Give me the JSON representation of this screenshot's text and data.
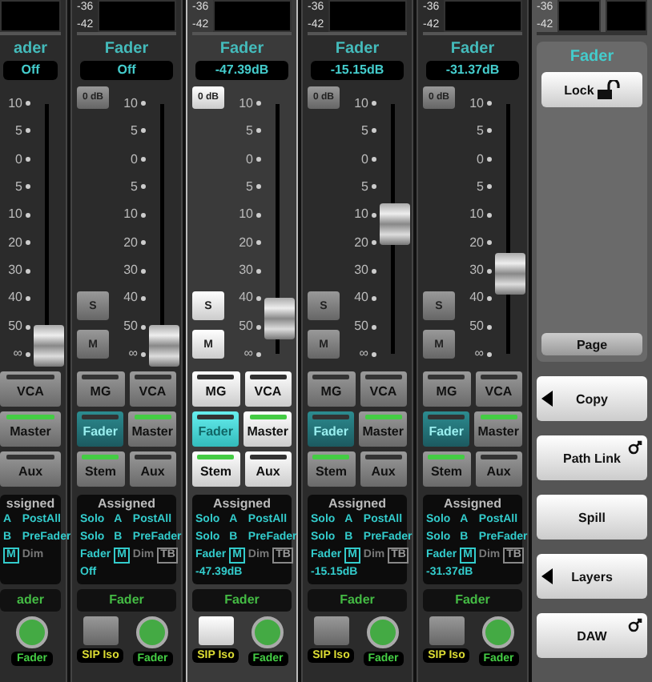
{
  "strips": [
    {
      "kind": "partial",
      "selected": false,
      "title": "ader",
      "value": "Off",
      "scale": [
        "10",
        "5",
        "0",
        "5",
        "10",
        "20",
        "30",
        "40",
        "50",
        "∞"
      ],
      "level": 0.03,
      "buttons": [
        [
          {
            "label": "VCA",
            "lit": false,
            "highlighted": false
          }
        ],
        [
          {
            "label": "Master",
            "lit": true,
            "highlighted": false
          }
        ],
        [
          {
            "label": "Aux",
            "lit": false,
            "highlighted": false
          }
        ]
      ],
      "assigned": {
        "title": "ssigned",
        "rows": [
          [
            {
              "text": "A",
              "kind": "text"
            },
            {
              "text": "PostAll",
              "kind": "text"
            }
          ],
          [
            {
              "text": "B",
              "kind": "text"
            },
            {
              "text": "PreFader",
              "kind": "text"
            }
          ],
          [
            {
              "text": "M",
              "kind": "box"
            },
            {
              "text": "Dim",
              "kind": "dim"
            }
          ]
        ]
      },
      "bar_label": "ader",
      "bottom": [
        {
          "kind": "round",
          "label": "Fader"
        }
      ]
    },
    {
      "kind": "full",
      "selected": false,
      "meter_labels": [
        "-36",
        "-42"
      ],
      "title": "Fader",
      "value": "Off",
      "zero_db": "0 dB",
      "scale": [
        "10",
        "5",
        "0",
        "5",
        "10",
        "20",
        "30",
        "40",
        "50",
        "∞"
      ],
      "level": 0.03,
      "solo": "S",
      "mute": "M",
      "buttons": [
        [
          {
            "label": "MG",
            "lit": false,
            "highlighted": false
          },
          {
            "label": "VCA",
            "lit": false,
            "highlighted": false
          }
        ],
        [
          {
            "label": "Fader",
            "lit": false,
            "highlighted": true
          },
          {
            "label": "Master",
            "lit": true,
            "highlighted": false
          }
        ],
        [
          {
            "label": "Stem",
            "lit": true,
            "highlighted": false
          },
          {
            "label": "Aux",
            "lit": false,
            "highlighted": false
          }
        ]
      ],
      "assigned": {
        "title": "Assigned",
        "rows": [
          [
            {
              "text": "Solo",
              "kind": "text"
            },
            {
              "text": "A",
              "kind": "text"
            },
            {
              "text": "PostAll",
              "kind": "text"
            }
          ],
          [
            {
              "text": "Solo",
              "kind": "text"
            },
            {
              "text": "B",
              "kind": "text"
            },
            {
              "text": "PreFader",
              "kind": "text"
            }
          ],
          [
            {
              "text": "Fader",
              "kind": "text"
            },
            {
              "text": "M",
              "kind": "box"
            },
            {
              "text": "Dim",
              "kind": "dim"
            },
            {
              "text": "TB",
              "kind": "dimbox"
            }
          ],
          [
            {
              "text": "Off",
              "kind": "text"
            }
          ]
        ]
      },
      "bar_label": "Fader",
      "bottom": [
        {
          "kind": "square",
          "label": "SIP Iso"
        },
        {
          "kind": "round",
          "label": "Fader"
        }
      ]
    },
    {
      "kind": "full",
      "selected": true,
      "meter_labels": [
        "-36",
        "-42"
      ],
      "title": "Fader",
      "value": "-47.39dB",
      "zero_db": "0 dB",
      "scale": [
        "10",
        "5",
        "0",
        "5",
        "10",
        "20",
        "30",
        "40",
        "50",
        "∞"
      ],
      "level": 0.14,
      "solo": "S",
      "mute": "M",
      "buttons": [
        [
          {
            "label": "MG",
            "lit": false,
            "highlighted": false
          },
          {
            "label": "VCA",
            "lit": false,
            "highlighted": false
          }
        ],
        [
          {
            "label": "Fader",
            "lit": false,
            "highlighted": true
          },
          {
            "label": "Master",
            "lit": true,
            "highlighted": false
          }
        ],
        [
          {
            "label": "Stem",
            "lit": true,
            "highlighted": false
          },
          {
            "label": "Aux",
            "lit": false,
            "highlighted": false
          }
        ]
      ],
      "assigned": {
        "title": "Assigned",
        "rows": [
          [
            {
              "text": "Solo",
              "kind": "text"
            },
            {
              "text": "A",
              "kind": "text"
            },
            {
              "text": "PostAll",
              "kind": "text"
            }
          ],
          [
            {
              "text": "Solo",
              "kind": "text"
            },
            {
              "text": "B",
              "kind": "text"
            },
            {
              "text": "PreFader",
              "kind": "text"
            }
          ],
          [
            {
              "text": "Fader",
              "kind": "text"
            },
            {
              "text": "M",
              "kind": "box"
            },
            {
              "text": "Dim",
              "kind": "dim"
            },
            {
              "text": "TB",
              "kind": "dimbox"
            }
          ],
          [
            {
              "text": "-47.39dB",
              "kind": "text"
            }
          ]
        ]
      },
      "bar_label": "Fader",
      "bottom": [
        {
          "kind": "square",
          "label": "SIP Iso"
        },
        {
          "kind": "round",
          "label": "Fader"
        }
      ]
    },
    {
      "kind": "full",
      "selected": false,
      "meter_labels": [
        "-36",
        "-42"
      ],
      "title": "Fader",
      "value": "-15.15dB",
      "zero_db": "0 dB",
      "scale": [
        "10",
        "5",
        "0",
        "5",
        "10",
        "20",
        "30",
        "40",
        "50",
        "∞"
      ],
      "level": 0.52,
      "solo": "S",
      "mute": "M",
      "buttons": [
        [
          {
            "label": "MG",
            "lit": false,
            "highlighted": false
          },
          {
            "label": "VCA",
            "lit": false,
            "highlighted": false
          }
        ],
        [
          {
            "label": "Fader",
            "lit": false,
            "highlighted": true
          },
          {
            "label": "Master",
            "lit": true,
            "highlighted": false
          }
        ],
        [
          {
            "label": "Stem",
            "lit": true,
            "highlighted": false
          },
          {
            "label": "Aux",
            "lit": false,
            "highlighted": false
          }
        ]
      ],
      "assigned": {
        "title": "Assigned",
        "rows": [
          [
            {
              "text": "Solo",
              "kind": "text"
            },
            {
              "text": "A",
              "kind": "text"
            },
            {
              "text": "PostAll",
              "kind": "text"
            }
          ],
          [
            {
              "text": "Solo",
              "kind": "text"
            },
            {
              "text": "B",
              "kind": "text"
            },
            {
              "text": "PreFader",
              "kind": "text"
            }
          ],
          [
            {
              "text": "Fader",
              "kind": "text"
            },
            {
              "text": "M",
              "kind": "box"
            },
            {
              "text": "Dim",
              "kind": "dim"
            },
            {
              "text": "TB",
              "kind": "dimbox"
            }
          ],
          [
            {
              "text": "-15.15dB",
              "kind": "text"
            }
          ]
        ]
      },
      "bar_label": "Fader",
      "bottom": [
        {
          "kind": "square",
          "label": "SIP Iso"
        },
        {
          "kind": "round",
          "label": "Fader"
        }
      ]
    },
    {
      "kind": "full",
      "selected": false,
      "meter_labels": [
        "-36",
        "-42"
      ],
      "title": "Fader",
      "value": "-31.37dB",
      "zero_db": "0 dB",
      "scale": [
        "10",
        "5",
        "0",
        "5",
        "10",
        "20",
        "30",
        "40",
        "50",
        "∞"
      ],
      "level": 0.32,
      "solo": "S",
      "mute": "M",
      "buttons": [
        [
          {
            "label": "MG",
            "lit": false,
            "highlighted": false
          },
          {
            "label": "VCA",
            "lit": false,
            "highlighted": false
          }
        ],
        [
          {
            "label": "Fader",
            "lit": false,
            "highlighted": true
          },
          {
            "label": "Master",
            "lit": true,
            "highlighted": false
          }
        ],
        [
          {
            "label": "Stem",
            "lit": true,
            "highlighted": false
          },
          {
            "label": "Aux",
            "lit": false,
            "highlighted": false
          }
        ]
      ],
      "assigned": {
        "title": "Assigned",
        "rows": [
          [
            {
              "text": "Solo",
              "kind": "text"
            },
            {
              "text": "A",
              "kind": "text"
            },
            {
              "text": "PostAll",
              "kind": "text"
            }
          ],
          [
            {
              "text": "Solo",
              "kind": "text"
            },
            {
              "text": "B",
              "kind": "text"
            },
            {
              "text": "PreFader",
              "kind": "text"
            }
          ],
          [
            {
              "text": "Fader",
              "kind": "text"
            },
            {
              "text": "M",
              "kind": "box"
            },
            {
              "text": "Dim",
              "kind": "dim"
            },
            {
              "text": "TB",
              "kind": "dimbox"
            }
          ],
          [
            {
              "text": "-31.37dB",
              "kind": "text"
            }
          ]
        ]
      },
      "bar_label": "Fader",
      "bottom": [
        {
          "kind": "square",
          "label": "SIP Iso"
        },
        {
          "kind": "round",
          "label": "Fader"
        }
      ]
    }
  ],
  "panel": {
    "meter_labels": [
      "-36",
      "-42"
    ],
    "title": "Fader",
    "lock": {
      "label": "Lock"
    },
    "page": {
      "label": "Page"
    },
    "buttons": [
      {
        "label": "Copy",
        "kind": "arrow"
      },
      {
        "label": "Path Link",
        "kind": "link"
      },
      {
        "label": "Spill",
        "kind": "plain"
      },
      {
        "label": "Layers",
        "kind": "arrow"
      },
      {
        "label": "DAW",
        "kind": "link"
      }
    ]
  }
}
